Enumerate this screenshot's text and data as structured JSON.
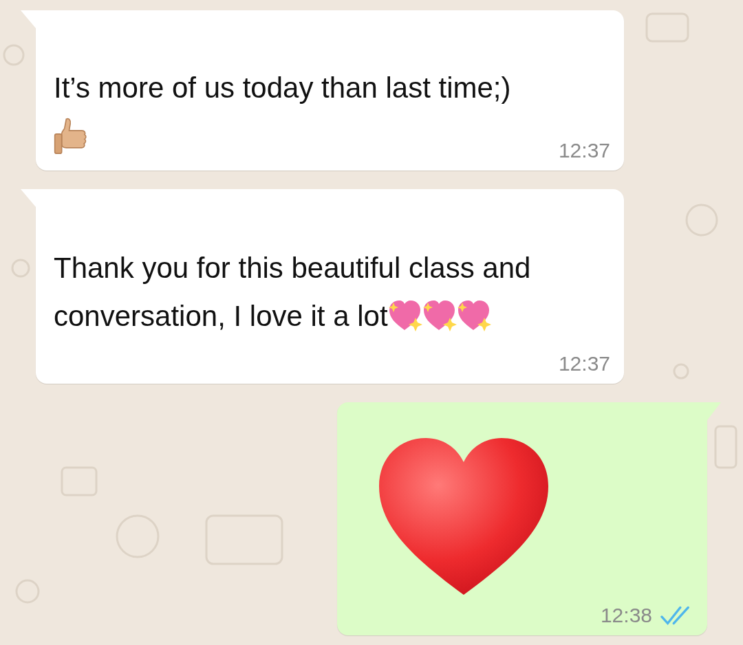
{
  "messages": [
    {
      "outgoing": false,
      "kind": "thumbs",
      "lines": [
        "It’s more of us today than last time;)"
      ],
      "time": "12:37"
    },
    {
      "outgoing": false,
      "kind": "hearts",
      "lines": [
        "Thank you for this beautiful class and",
        "conversation, I love it a lot"
      ],
      "time": "12:37"
    },
    {
      "outgoing": true,
      "kind": "heart",
      "time": "12:38",
      "read": true
    }
  ]
}
